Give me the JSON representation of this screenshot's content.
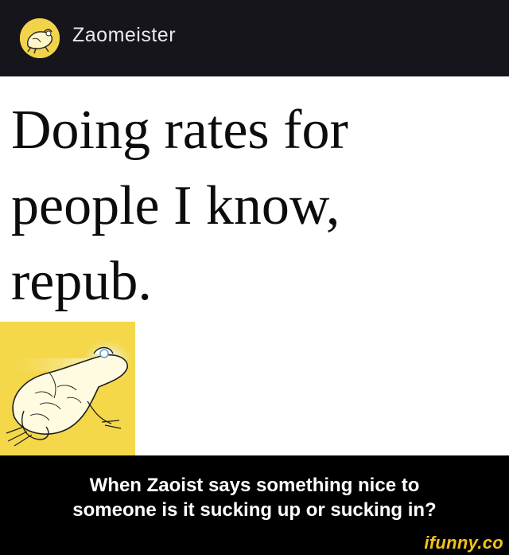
{
  "header": {
    "username": "Zaomeister",
    "avatar_icon": "frog-avatar-icon"
  },
  "post": {
    "text": "Doing rates for\npeople I know,\nrepub.",
    "image_icon": "glowing-frog-image",
    "image_background": "#f4d84a"
  },
  "caption": {
    "text": "When Zaoist says something nice to\nsomeone is it sucking up or sucking in?"
  },
  "watermark": {
    "text": "ifunny.co"
  },
  "colors": {
    "background": "#16151b",
    "post_background": "#ffffff",
    "caption_background": "#000000",
    "watermark": "#f2c21a"
  }
}
